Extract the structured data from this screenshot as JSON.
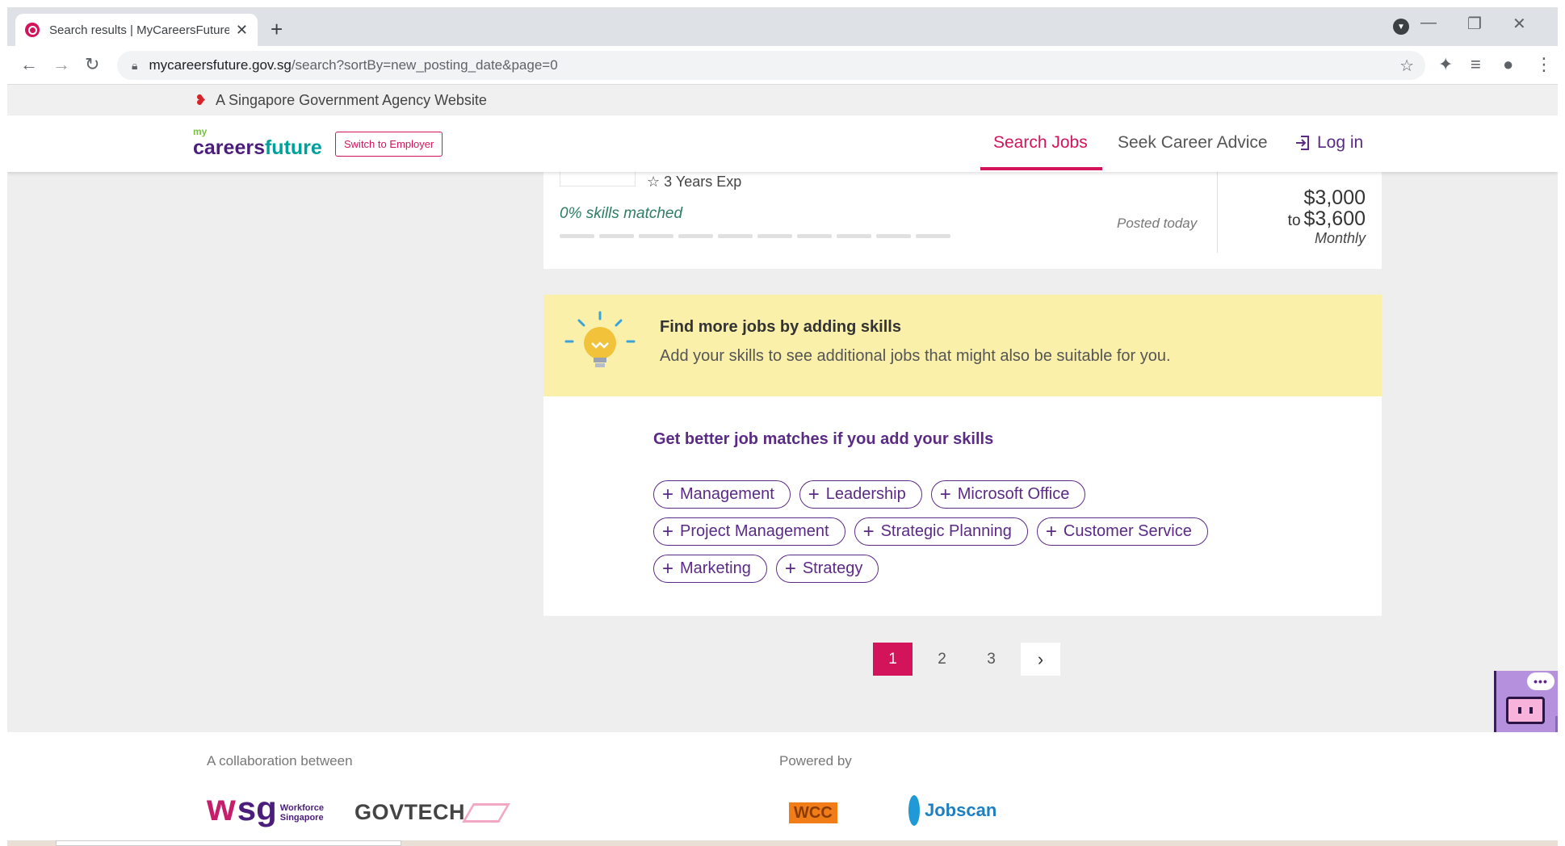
{
  "browser": {
    "tab_title": "Search results | MyCareersFuture",
    "tab_close": "✕",
    "new_tab": "+",
    "url_host": "mycareersfuture.gov.sg",
    "url_path": "/search?sortBy=new_posting_date&page=0"
  },
  "gov_banner": {
    "text": "A Singapore Government Agency Website"
  },
  "header": {
    "logo_my": "my",
    "logo_careers": "careers",
    "logo_future": "future",
    "switch_label": "Switch to Employer",
    "nav_search": "Search Jobs",
    "nav_advice": "Seek Career Advice",
    "nav_login": "Log in"
  },
  "job_card": {
    "experience": "3 Years Exp",
    "skills_matched": "0% skills matched",
    "posted": "Posted today",
    "salary_from": "$3,000",
    "salary_to_prefix": "to",
    "salary_to": "$3,600",
    "salary_period": "Monthly"
  },
  "skills_promo": {
    "title": "Find more jobs by adding skills",
    "description": "Add your skills to see additional jobs that might also be suitable for you."
  },
  "skills_panel": {
    "title": "Get better job matches if you add your skills",
    "rows": [
      [
        "Management",
        "Leadership",
        "Microsoft Office"
      ],
      [
        "Project Management",
        "Strategic Planning",
        "Customer Service"
      ],
      [
        "Marketing",
        "Strategy"
      ]
    ]
  },
  "pagination": {
    "pages": [
      "1",
      "2",
      "3"
    ],
    "current": "1",
    "next": "›"
  },
  "chatbot": {
    "bubble": "•••"
  },
  "footer": {
    "collab_label": "A collaboration between",
    "powered_label": "Powered by",
    "wsg_w": "w",
    "wsg_sg": "sg",
    "wsg_sub_1": "Workforce",
    "wsg_sub_2": "Singapore",
    "govtech": "GOVTECH",
    "wcc_box": "WCC",
    "jobscan": "Jobscan"
  },
  "colors": {
    "brand_magenta": "#d4145a",
    "brand_purple": "#5b2a86",
    "promo_yellow": "#faf0aa"
  }
}
